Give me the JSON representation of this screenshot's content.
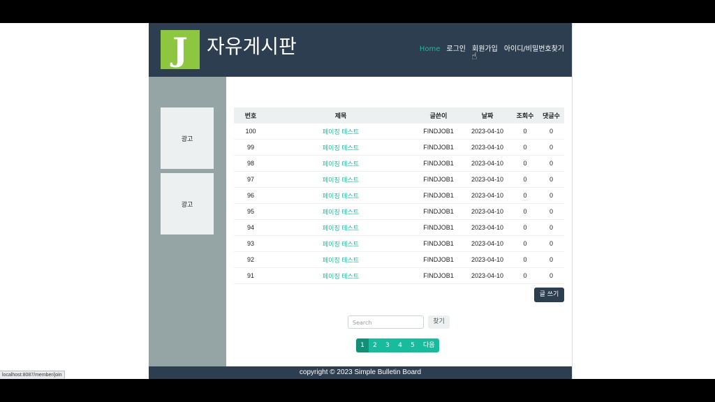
{
  "header": {
    "logo_letter": "J",
    "title": "자유게시판",
    "nav": [
      {
        "label": "Home",
        "active": true
      },
      {
        "label": "로그인",
        "active": false
      },
      {
        "label": "회원가입",
        "active": false
      },
      {
        "label": "아이디/비밀번호찾기",
        "active": false
      }
    ]
  },
  "sidebar": {
    "ads": [
      "광고",
      "광고"
    ]
  },
  "board": {
    "columns": [
      "번호",
      "제목",
      "글쓴이",
      "날짜",
      "조회수",
      "댓글수"
    ],
    "rows": [
      {
        "no": "100",
        "title": "페이징 테스트",
        "writer": "FINDJOB1",
        "date": "2023-04-10",
        "views": "0",
        "comments": "0"
      },
      {
        "no": "99",
        "title": "페이징 테스트",
        "writer": "FINDJOB1",
        "date": "2023-04-10",
        "views": "0",
        "comments": "0"
      },
      {
        "no": "98",
        "title": "페이징 테스트",
        "writer": "FINDJOB1",
        "date": "2023-04-10",
        "views": "0",
        "comments": "0"
      },
      {
        "no": "97",
        "title": "페이징 테스트",
        "writer": "FINDJOB1",
        "date": "2023-04-10",
        "views": "0",
        "comments": "0"
      },
      {
        "no": "96",
        "title": "페이징 테스트",
        "writer": "FINDJOB1",
        "date": "2023-04-10",
        "views": "0",
        "comments": "0"
      },
      {
        "no": "95",
        "title": "페이징 테스트",
        "writer": "FINDJOB1",
        "date": "2023-04-10",
        "views": "0",
        "comments": "0"
      },
      {
        "no": "94",
        "title": "페이징 테스트",
        "writer": "FINDJOB1",
        "date": "2023-04-10",
        "views": "0",
        "comments": "0"
      },
      {
        "no": "93",
        "title": "페이징 테스트",
        "writer": "FINDJOB1",
        "date": "2023-04-10",
        "views": "0",
        "comments": "0"
      },
      {
        "no": "92",
        "title": "페이징 테스트",
        "writer": "FINDJOB1",
        "date": "2023-04-10",
        "views": "0",
        "comments": "0"
      },
      {
        "no": "91",
        "title": "페이징 테스트",
        "writer": "FINDJOB1",
        "date": "2023-04-10",
        "views": "0",
        "comments": "0"
      }
    ],
    "write_button": "글 쓰기"
  },
  "search": {
    "placeholder": "Search",
    "button": "찾기"
  },
  "pagination": {
    "pages": [
      "1",
      "2",
      "3",
      "4",
      "5"
    ],
    "active": "1",
    "next": "다음"
  },
  "footer": {
    "text": "copyright © 2023 Simple Bulletin Board"
  },
  "status_bar": {
    "url": "localhost:8087/member/join"
  },
  "colors": {
    "header_bg": "#2c3e50",
    "accent": "#18bc9c",
    "logo_bg": "#8dc63f",
    "sidebar_bg": "#95a5a6"
  }
}
